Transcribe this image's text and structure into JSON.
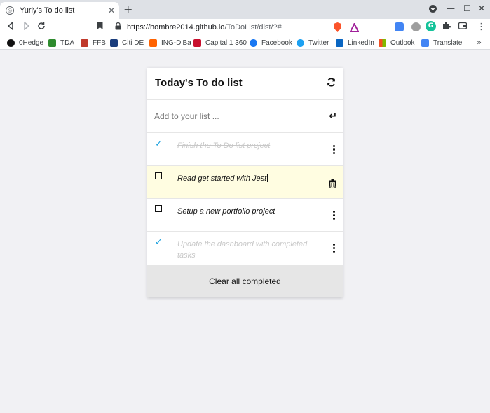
{
  "browser": {
    "tab_title": "Yuriy's To do list",
    "url_host": "https://hombre2014.github.io",
    "url_path": "/ToDoList/dist/?#",
    "bookmarks": [
      {
        "label": "0Hedge",
        "icon": "zerohedge-icon",
        "color": "#111111"
      },
      {
        "label": "TDA",
        "icon": "td-icon",
        "color": "#2e8b2e"
      },
      {
        "label": "FFB",
        "icon": "ffb-icon",
        "color": "#c0392b"
      },
      {
        "label": "Citi DE",
        "icon": "citi-icon",
        "color": "#1a3d7c"
      },
      {
        "label": "ING-DiBa",
        "icon": "ing-icon",
        "color": "#ff6200"
      },
      {
        "label": "Capital 1 360",
        "icon": "capitalone-icon",
        "color": "#c8102e"
      },
      {
        "label": "Facebook",
        "icon": "facebook-icon",
        "color": "#1877f2"
      },
      {
        "label": "Twitter",
        "icon": "twitter-icon",
        "color": "#1da1f2"
      },
      {
        "label": "LinkedIn",
        "icon": "linkedin-icon",
        "color": "#0a66c2"
      },
      {
        "label": "Outlook",
        "icon": "microsoft-icon",
        "color": "#f25022"
      },
      {
        "label": "Translate",
        "icon": "translate-icon",
        "color": "#4285f4"
      }
    ]
  },
  "app": {
    "title": "Today's To do list",
    "add_placeholder": "Add to your list ...",
    "clear_label": "Clear all completed",
    "accent_color": "#1ba1de",
    "editing_bg": "#fffde1",
    "items": [
      {
        "text": "Finish the To Do list project",
        "completed": true
      },
      {
        "text": "Read get started with Jest",
        "completed": false,
        "editing": true
      },
      {
        "text": "Setup a new portfolio project",
        "completed": false
      },
      {
        "text": "Update the dashboard with completed tasks",
        "completed": true
      }
    ]
  }
}
